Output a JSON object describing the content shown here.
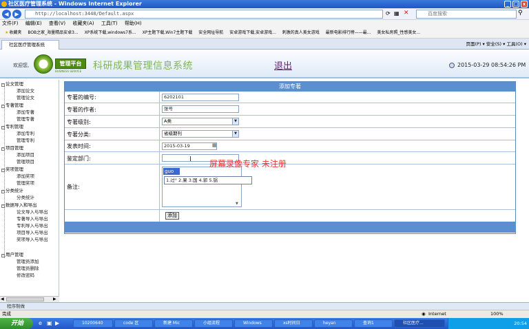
{
  "window": {
    "title": "社区医疗管理系统 - Windows Internet Explorer"
  },
  "browser": {
    "url": "http://localhost:3448/Default.aspx",
    "search_placeholder": "百度搜索",
    "menu": [
      "文件(F)",
      "编辑(E)",
      "查看(V)",
      "收藏夹(A)",
      "工具(T)",
      "帮助(H)"
    ],
    "favorites_label": "收藏夹",
    "favorites": [
      "BOB之家_海量精品安卓3...",
      "XP系统下载,windows7系...",
      "XP主题下载,Win7主题下载",
      "安全网址导航",
      "安卓游戏下载,安卓游戏...",
      "刺激的真人美女游戏",
      "最新电影排行榜——最...",
      "美女私房照_性感美女..."
    ],
    "tab_label": "社区医疗管理系统",
    "toolbar_tools": "页面(P) ▾  安全(S) ▾  工具(O) ▾"
  },
  "header": {
    "welcome": "欢迎您,",
    "logo_text": "管理平台",
    "logo_sub": "BUSINESS SERVICE",
    "system_title": "科研成果管理信息系统",
    "logout": "退出",
    "datetime": "2015-03-29 08:54:26 PM"
  },
  "sidebar": {
    "groups": [
      {
        "label": "论文管理",
        "items": [
          "添加论文",
          "管理论文"
        ]
      },
      {
        "label": "专著管理",
        "items": [
          "添加专著",
          "管理专著"
        ]
      },
      {
        "label": "专利管理",
        "items": [
          "添加专利",
          "管理专利"
        ]
      },
      {
        "label": "项目管理",
        "items": [
          "添加项目",
          "管理项目"
        ]
      },
      {
        "label": "奖项管理",
        "items": [
          "添加奖项",
          "管理奖项"
        ]
      },
      {
        "label": "分类统计",
        "items": [
          "分类统计"
        ]
      },
      {
        "label": "数据导入和导出",
        "items": [
          "论文导入与导出",
          "专著导入与导出",
          "专利导入与导出",
          "项目导入与导出",
          "奖项导入与导出"
        ]
      },
      {
        "label": "用户管理",
        "items": [
          "管理员添加",
          "管理员删除",
          "修改密码"
        ]
      }
    ],
    "progress_label": "程序制做"
  },
  "form": {
    "heading": "添加专著",
    "fields": {
      "code": {
        "label": "专著的编号:",
        "value": "6202101"
      },
      "author": {
        "label": "专著的作者:",
        "value": "张号"
      },
      "level": {
        "label": "专著级别:",
        "value": "A类"
      },
      "category": {
        "label": "专著分类:",
        "value": "省级期刊"
      },
      "date": {
        "label": "发表时间:",
        "value": "2015-03-19"
      },
      "dept": {
        "label": "鉴定部门:",
        "value": ""
      },
      "notes": {
        "label": "备注:"
      }
    },
    "submit_label": "添加"
  },
  "ime": {
    "input": "guo",
    "candidates": "1.过° 2.果 3.国 4.郭 5.锅"
  },
  "watermark": "屏幕录像专家  未注册",
  "status": {
    "left": "完成",
    "zone": "Internet",
    "zoom": "100%"
  },
  "taskbar": {
    "start": "开始",
    "buttons": [
      "10200640",
      "code 区",
      "新建 Mic",
      "小组流程",
      "Windows",
      "xs时间日",
      "heyan",
      "查询1",
      "社区医疗..."
    ],
    "clock": "20:54"
  }
}
